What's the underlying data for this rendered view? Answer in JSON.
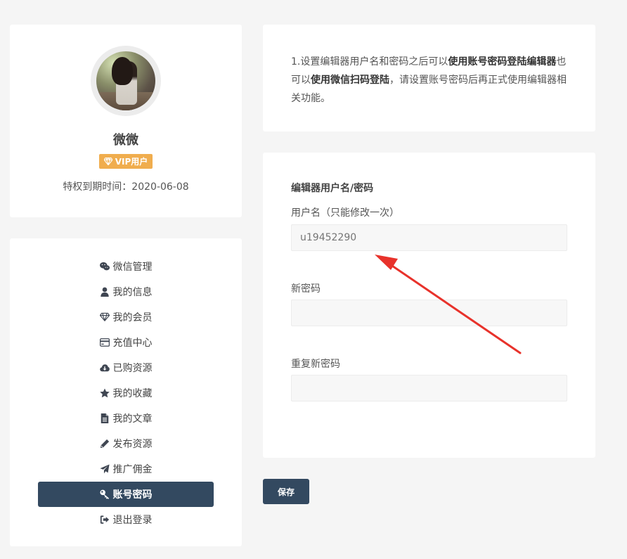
{
  "profile": {
    "username": "微微",
    "vip_label": "VIP用户",
    "expire_text": "特权到期时间：2020-06-08"
  },
  "menu": {
    "items": [
      {
        "label": "微信管理",
        "icon": "wechat-icon"
      },
      {
        "label": "我的信息",
        "icon": "user-icon"
      },
      {
        "label": "我的会员",
        "icon": "diamond-icon"
      },
      {
        "label": "充值中心",
        "icon": "credit-card-icon"
      },
      {
        "label": "已购资源",
        "icon": "cloud-download-icon"
      },
      {
        "label": "我的收藏",
        "icon": "star-icon"
      },
      {
        "label": "我的文章",
        "icon": "file-icon"
      },
      {
        "label": "发布资源",
        "icon": "pencil-icon"
      },
      {
        "label": "推广佣金",
        "icon": "send-icon"
      },
      {
        "label": "账号密码",
        "icon": "key-icon",
        "active": true
      },
      {
        "label": "退出登录",
        "icon": "sign-out-icon"
      }
    ]
  },
  "notice": {
    "part1": "1.设置编辑器用户名和密码之后可以",
    "bold1": "使用账号密码登陆编辑器",
    "part2": "也可以",
    "bold2": "使用微信扫码登陆",
    "part3": "，请设置账号密码后再正式使用编辑器相关功能。"
  },
  "form": {
    "section_title": "编辑器用户名/密码",
    "username_label": "用户名（只能修改一次）",
    "username_placeholder": "u19452290",
    "new_password_label": "新密码",
    "repeat_password_label": "重复新密码",
    "save_label": "保存"
  },
  "colors": {
    "accent": "#334960",
    "vip": "#f0ad4e",
    "arrow": "#e8322b"
  }
}
